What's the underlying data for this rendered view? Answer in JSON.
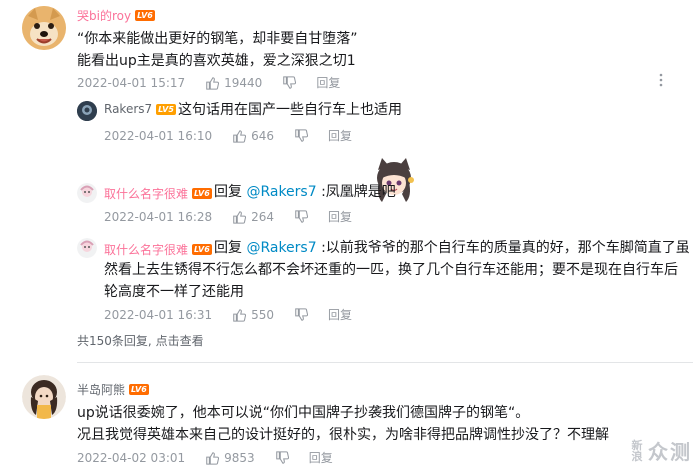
{
  "comments": [
    {
      "username": "哭bi的roy",
      "level": "LV6",
      "text_lines": [
        "“你本来能做出更好的钢笔，却非要自甘堕落”",
        "能看出up主是真的喜欢英雄，爱之深狠之切1"
      ],
      "date": "2022-04-01 15:17",
      "likes": "19440",
      "reply_label": "回复"
    },
    {
      "username": "Rakers7",
      "level": "LV5",
      "text": "这句话用在国产一些自行车上也适用",
      "date": "2022-04-01 16:10",
      "likes": "646",
      "reply_label": "回复"
    },
    {
      "username": "取什么名字很难",
      "level": "LV6",
      "reply_prefix": "回复",
      "mention": "@Rakers7",
      "text": " :凤凰牌是吧",
      "date": "2022-04-01 16:28",
      "likes": "264",
      "reply_label": "回复"
    },
    {
      "username": "取什么名字很难",
      "level": "LV6",
      "reply_prefix": "回复",
      "mention": "@Rakers7",
      "text": " :以前我爷爷的那个自行车的质量真的好，那个车脚简直了虽然看上去生锈得不行怎么都不会坏还重的一匹，换了几个自行车还能用；要不是现在自行车后轮高度不一样了还能用",
      "date": "2022-04-01 16:31",
      "likes": "550",
      "reply_label": "回复"
    },
    {
      "username": "半岛阿熊",
      "level": "LV6",
      "text_lines": [
        "up说话很委婉了，他本可以说“你们中国牌子抄袭我们德国牌子的钢笔“。",
        "况且我觉得英雄本来自己的设计挺好的，很朴实，为啥非得把品牌调性抄没了？不理解"
      ],
      "date": "2022-04-02 03:01",
      "likes": "9853",
      "reply_label": "回复"
    }
  ],
  "summary": {
    "text": "共150条回复,",
    "link": "点击查看"
  },
  "watermark": {
    "small": "新浪",
    "large": "众测"
  },
  "colors": {
    "username_pink": "#fb7299",
    "username_plain": "#61666d",
    "lv6": "#ff6c00",
    "lv5": "#ff9f00",
    "mention": "#008ac5",
    "meta": "#9499a0"
  }
}
